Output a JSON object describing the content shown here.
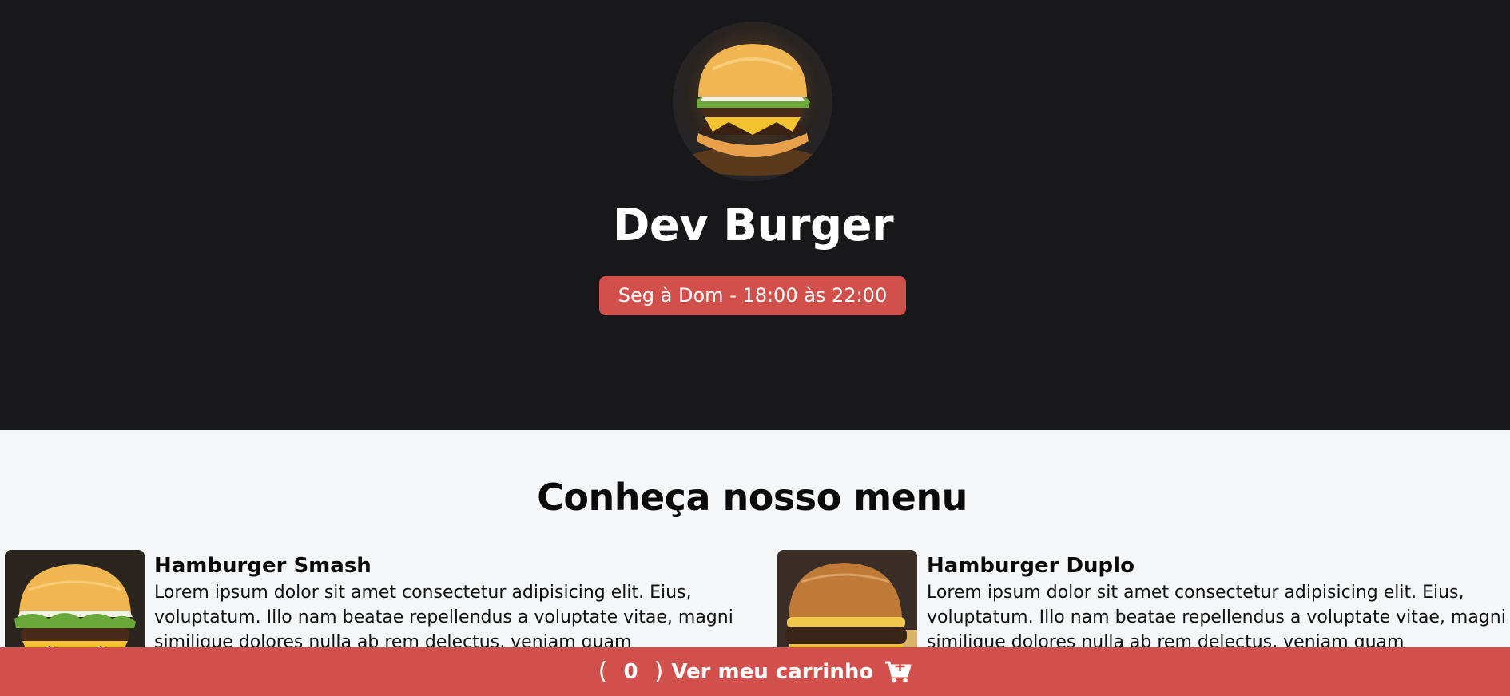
{
  "header": {
    "logo_icon": "burger-logo-image",
    "title": "Dev Burger",
    "hours": "Seg à Dom - 18:00 às 22:00",
    "background_color": "#18181b",
    "badge_color": "#d1504c"
  },
  "menu": {
    "title": "Conheça nosso menu",
    "products": [
      {
        "name": "Hamburger Smash",
        "description": "Lorem ipsum dolor sit amet consectetur adipisicing elit. Eius, voluptatum. Illo nam beatae repellendus a voluptate vitae, magni similique dolores nulla ab rem delectus, veniam quam"
      },
      {
        "name": "Hamburger Duplo",
        "description": "Lorem ipsum dolor sit amet consectetur adipisicing elit. Eius, voluptatum. Illo nam beatae repellendus a voluptate vitae, magni similique dolores nulla ab rem delectus, veniam quam"
      }
    ]
  },
  "cart": {
    "open_paren": "(",
    "count": "0",
    "close_paren": ")",
    "label": "Ver meu carrinho",
    "icon": "cart-plus-icon",
    "background_color": "#d1504c"
  }
}
